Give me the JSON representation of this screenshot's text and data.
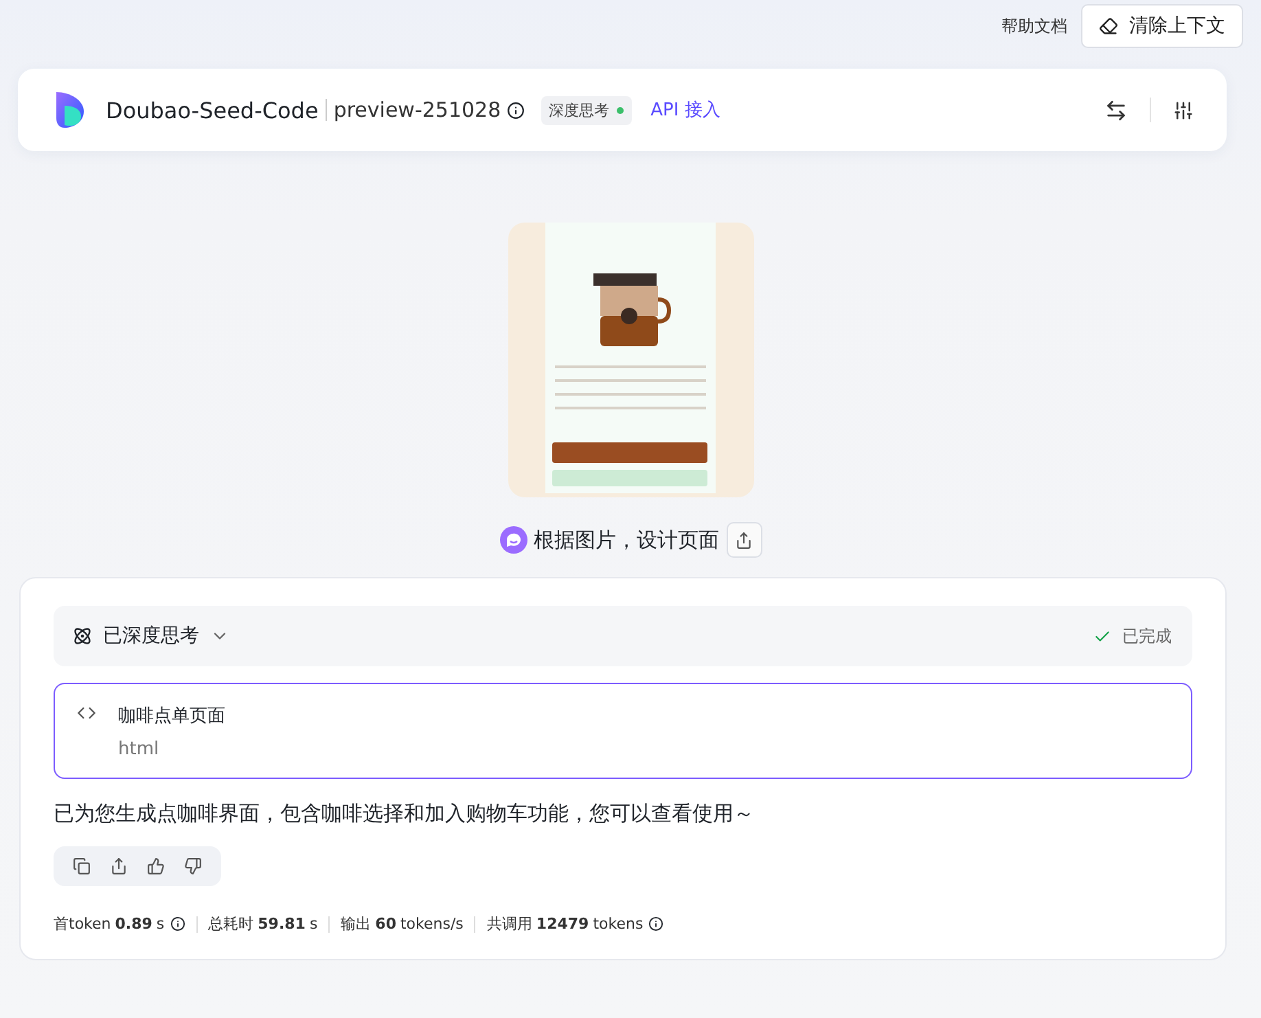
{
  "top_bar": {
    "help_link": "帮助文档",
    "clear_button": "清除上下文"
  },
  "header": {
    "model_name": "Doubao-Seed-Code",
    "version": "preview-251028",
    "mode_tag": {
      "label": "深度思考",
      "on": true
    },
    "api_link": "API 接入"
  },
  "user_message": {
    "text": "根据图片，设计页面"
  },
  "answer": {
    "thinking": {
      "label": "已深度思考",
      "expanded": false,
      "status": "已完成"
    },
    "artifact": {
      "title": "咖啡点单页面",
      "type": "html",
      "selected": true
    },
    "text": "已为您生成点咖啡界面，包含咖啡选择和加入购物车功能，您可以查看使用～",
    "stats": [
      {
        "label": "首token",
        "value": "0.89",
        "unit": "s",
        "info": true
      },
      {
        "label": "总耗时",
        "value": "59.81",
        "unit": "s",
        "info": false
      },
      {
        "label": "输出",
        "value": "60",
        "unit": "tokens/s",
        "info": false
      },
      {
        "label": "共调用",
        "value": "12479",
        "unit": "tokens",
        "info": true
      }
    ]
  }
}
